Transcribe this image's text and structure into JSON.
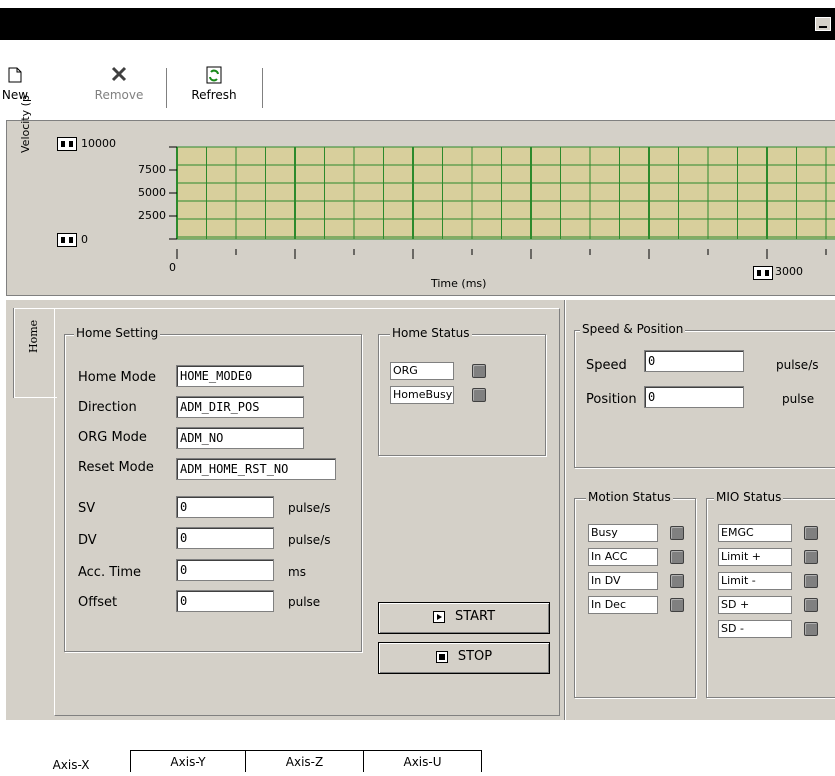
{
  "toolbar": {
    "new_label": "New",
    "remove_label": "Remove",
    "refresh_label": "Refresh"
  },
  "chart_data": {
    "type": "line",
    "ylabel": "Velocity (p",
    "xlabel": "Time (ms)",
    "y_ticks": [
      "10000",
      "7500",
      "5000",
      "2500",
      "0"
    ],
    "x_ticks": [
      "0",
      "3000"
    ],
    "ylim": [
      0,
      10000
    ],
    "xlim": [
      0,
      3000
    ],
    "grid": true,
    "series": []
  },
  "home_tab": {
    "label": "Home"
  },
  "home_setting": {
    "title": "Home Setting",
    "home_mode_label": "Home Mode",
    "home_mode_value": "HOME_MODE0",
    "direction_label": "Direction",
    "direction_value": "ADM_DIR_POS",
    "org_mode_label": "ORG Mode",
    "org_mode_value": "ADM_NO",
    "reset_mode_label": "Reset Mode",
    "reset_mode_value": "ADM_HOME_RST_NO",
    "sv_label": "SV",
    "sv_value": "0",
    "sv_unit": "pulse/s",
    "dv_label": "DV",
    "dv_value": "0",
    "dv_unit": "pulse/s",
    "acc_label": "Acc. Time",
    "acc_value": "0",
    "acc_unit": "ms",
    "offset_label": "Offset",
    "offset_value": "0",
    "offset_unit": "pulse"
  },
  "home_status": {
    "title": "Home Status",
    "org": "ORG",
    "homebusy": "HomeBusy"
  },
  "buttons": {
    "start": "START",
    "stop": "STOP"
  },
  "speed_position": {
    "title": "Speed & Position",
    "speed_label": "Speed",
    "speed_value": "0",
    "speed_unit": "pulse/s",
    "position_label": "Position",
    "position_value": "0",
    "position_unit": "pulse"
  },
  "motion_status": {
    "title": "Motion Status",
    "items": [
      "Busy",
      "In ACC",
      "In DV",
      "In Dec"
    ]
  },
  "mio_status": {
    "title": "MIO Status",
    "items": [
      "EMGC",
      "Limit +",
      "Limit -",
      "SD +",
      "SD -"
    ]
  },
  "axis_tabs": [
    "Axis-X",
    "Axis-Y",
    "Axis-Z",
    "Axis-U"
  ]
}
